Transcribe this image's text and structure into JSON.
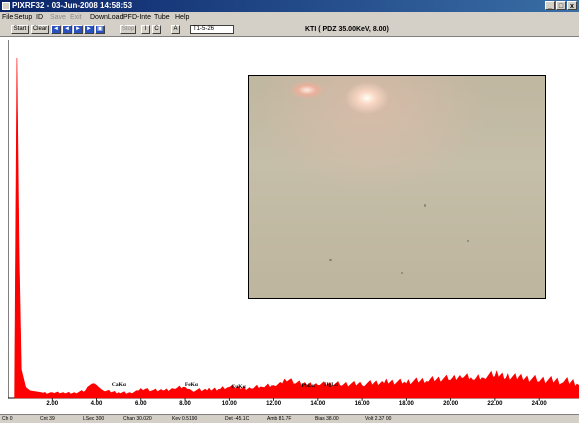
{
  "window": {
    "title": "PIXRF32 - 03-Jun-2008 14:58:53",
    "buttons": [
      "_",
      "□",
      "x"
    ]
  },
  "menu": [
    {
      "label": "File",
      "enabled": true
    },
    {
      "label": "Setup",
      "enabled": true
    },
    {
      "label": "ID",
      "enabled": true
    },
    {
      "label": "Save",
      "enabled": false
    },
    {
      "label": "Exit",
      "enabled": false
    },
    {
      "label": "DownLoad",
      "enabled": true
    },
    {
      "label": "PFD-Inte",
      "enabled": true
    },
    {
      "label": "Tube",
      "enabled": true
    },
    {
      "label": "Help",
      "enabled": true
    }
  ],
  "toolbar": {
    "start_label": "Start",
    "clear_label": "Clear",
    "nav_icons": [
      "first-icon",
      "prev-icon",
      "next-icon",
      "last-icon",
      "fit-icon"
    ],
    "disabled_label": "Stop",
    "button_i": "I",
    "button_c": "C",
    "button_a": "A",
    "sample_value": "T1-5-26",
    "info": "KTI  ( PDZ 35.00KeV, 8.00)"
  },
  "chart_data": {
    "type": "area",
    "title": "",
    "xlabel": "",
    "ylabel": "",
    "xlim": [
      0,
      25.8
    ],
    "ylim": [
      0,
      100
    ],
    "xticks": [
      "2.00",
      "4.00",
      "6.00",
      "8.00",
      "10.00",
      "12.00",
      "14.00",
      "16.00",
      "18.00",
      "20.00",
      "22.00",
      "24.00"
    ],
    "xtick_values": [
      2,
      4,
      6,
      8,
      10,
      12,
      14,
      16,
      18,
      20,
      22,
      24
    ],
    "series": [
      {
        "color": "#ff0000",
        "x": [
          0.3,
          0.4,
          0.5,
          0.6,
          0.8,
          1.0,
          1.5,
          2.0,
          2.5,
          3.0,
          3.5,
          3.7,
          3.9,
          4.1,
          4.3,
          5.0,
          5.5,
          5.9,
          6.2,
          6.5,
          7.0,
          7.5,
          8.0,
          8.3,
          9.0,
          9.6,
          10.0,
          10.5,
          11.0,
          11.5,
          12.0,
          12.4,
          12.7,
          13.0,
          13.5,
          14.0,
          15.0,
          16.0,
          17.0,
          18.0,
          19.0,
          20.0,
          20.5,
          21.0,
          21.5,
          22.0,
          22.5,
          23.0,
          24.0,
          25.0,
          25.8
        ],
        "y": [
          1,
          95,
          40,
          8,
          3,
          2,
          1.5,
          1.5,
          1.5,
          1.5,
          2,
          3.5,
          4,
          3,
          2,
          1.5,
          1.5,
          2,
          2.5,
          2,
          2,
          2.5,
          3,
          2,
          2,
          2.5,
          3,
          2.5,
          2.5,
          3,
          3.5,
          4,
          5,
          4,
          3.5,
          3.5,
          3.5,
          3.5,
          4,
          4,
          4.5,
          5,
          5.5,
          5,
          5.5,
          6,
          5.5,
          5,
          4.5,
          4,
          3.5
        ]
      }
    ],
    "annotations": [
      {
        "label": "CaKα",
        "x": 3.7
      },
      {
        "label": "FeKα",
        "x": 6.4
      },
      {
        "label": "CuKα",
        "x": 8.1
      },
      {
        "label": "HgLα",
        "x": 9.95
      },
      {
        "label": "PbLα",
        "x": 10.55
      }
    ]
  },
  "camera": {
    "alt": "sample-camera-view"
  },
  "status": [
    "Ch 0",
    "Cnt 39",
    "LSec 300",
    "Chan 30.020",
    "Kev 0.5190",
    "Det -45.1C",
    "Amb 81.7F",
    "Bias 38.00",
    "Volt 2.37 00"
  ]
}
